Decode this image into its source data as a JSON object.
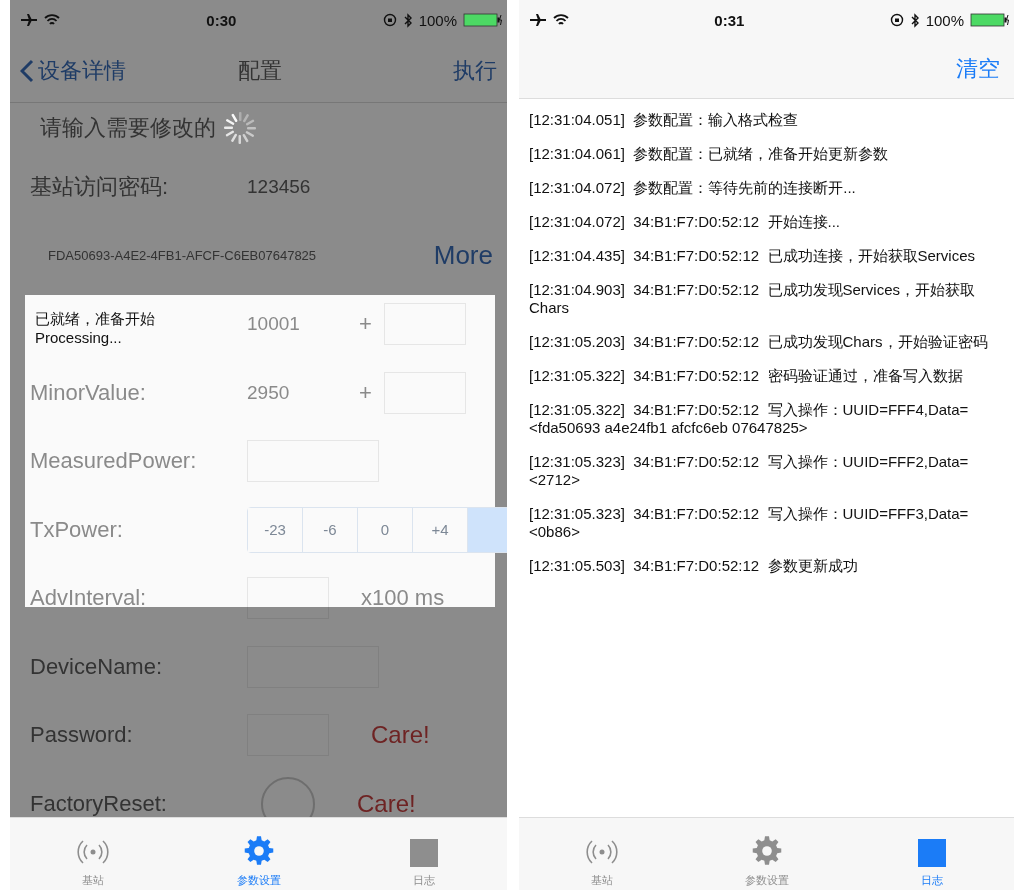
{
  "left_screen": {
    "status_bar": {
      "time": "0:30",
      "battery": "100%"
    },
    "nav": {
      "back": "设备详情",
      "title": "配置",
      "action": "执行"
    },
    "prompt": "请输入需要修改的",
    "form": [
      {
        "kind": "text",
        "label": "基站访问密码:",
        "value": "123456"
      },
      {
        "kind": "uuid",
        "value": "FDA50693-A4E2-4FB1-AFCF-C6EB07647825",
        "button": "More"
      },
      {
        "kind": "stepper",
        "value": "10001",
        "button": "+"
      },
      {
        "kind": "stepper",
        "label": "MinorValue:",
        "value": "2950",
        "button": "+"
      },
      {
        "kind": "input",
        "label": "MeasuredPower:"
      },
      {
        "kind": "segmented",
        "label": "TxPower:",
        "options": [
          {
            "label": "-23",
            "selected": false
          },
          {
            "label": "-6",
            "selected": false
          },
          {
            "label": "0",
            "selected": false
          },
          {
            "label": "+4",
            "selected": false
          },
          {
            "selected": true
          }
        ]
      },
      {
        "kind": "unit",
        "label": "AdvInterval:",
        "unit": "x100 ms"
      },
      {
        "kind": "input",
        "label": "DeviceName:"
      },
      {
        "kind": "warn",
        "label": "Password:",
        "warning": "Care!"
      },
      {
        "kind": "toggle",
        "label": "FactoryReset:",
        "on": false,
        "warning": "Care!"
      }
    ],
    "dialog": {
      "message": "已就绪，准备开始",
      "detail": "Processing..."
    },
    "tabs": [
      {
        "label": "基站",
        "selected": false
      },
      {
        "label": "参数设置",
        "selected": true
      },
      {
        "label": "日志",
        "selected": false
      }
    ]
  },
  "right_screen": {
    "status_bar": {
      "time": "0:31",
      "battery": "100%"
    },
    "nav": {
      "action": "清空"
    },
    "log": [
      "[12:31:04.051]  参数配置：输入格式检查",
      "[12:31:04.061]  参数配置：已就绪，准备开始更新参数",
      "[12:31:04.072]  参数配置：等待先前的连接断开...",
      "[12:31:04.072]  34:B1:F7:D0:52:12  开始连接...",
      "[12:31:04.435]  34:B1:F7:D0:52:12  已成功连接，开始获取Services",
      "[12:31:04.903]  34:B1:F7:D0:52:12  已成功发现Services，开始获取Chars",
      "[12:31:05.203]  34:B1:F7:D0:52:12  已成功发现Chars，开始验证密码",
      "[12:31:05.322]  34:B1:F7:D0:52:12  密码验证通过，准备写入数据",
      "[12:31:05.322]  34:B1:F7:D0:52:12  写入操作：UUID=FFF4,Data=<fda50693 a4e24fb1 afcfc6eb 07647825>",
      "[12:31:05.323]  34:B1:F7:D0:52:12  写入操作：UUID=FFF2,Data=<2712>",
      "[12:31:05.323]  34:B1:F7:D0:52:12  写入操作：UUID=FFF3,Data=<0b86>",
      "[12:31:05.503]  34:B1:F7:D0:52:12  参数更新成功"
    ],
    "tabs": [
      {
        "label": "基站",
        "selected": false
      },
      {
        "label": "参数设置",
        "selected": false
      },
      {
        "label": "日志",
        "selected": true
      }
    ]
  }
}
